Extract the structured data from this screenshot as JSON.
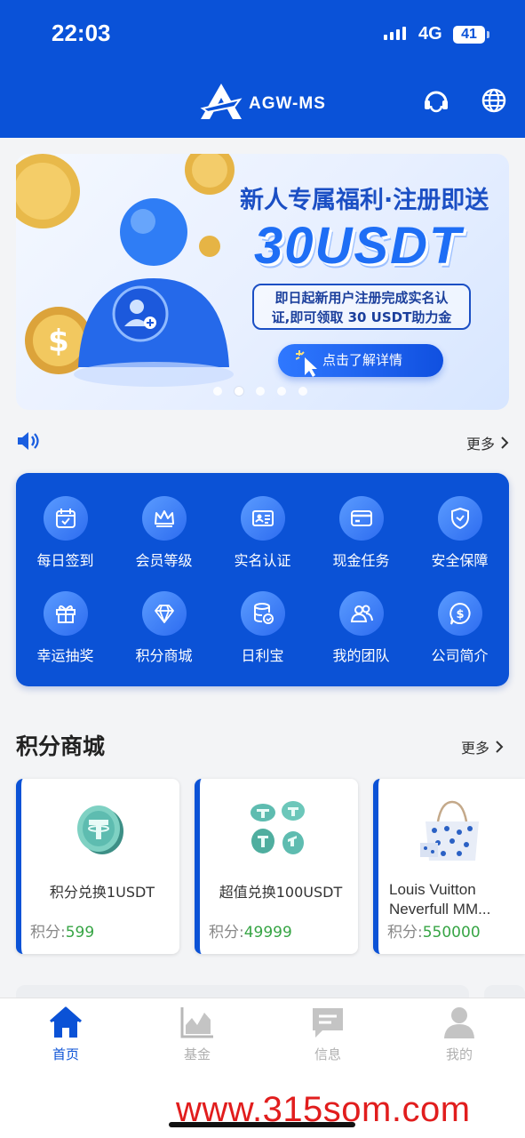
{
  "status_bar": {
    "time": "22:03",
    "network": "4G",
    "battery": "41"
  },
  "header": {
    "brand": "AGW-MS",
    "icons": [
      "headset-icon",
      "globe-icon"
    ]
  },
  "banner": {
    "title": "新人专属福利·注册即送",
    "amount": "30USDT",
    "desc_line1": "即日起新用户注册完成实名认",
    "desc_line2": "证,即可领取 30 USDT助力金",
    "button": "点击了解详情",
    "active_slide": 2,
    "slide_count": 5
  },
  "notice": {
    "more": "更多"
  },
  "quick_menu": [
    {
      "label": "每日签到",
      "icon": "calendar-icon"
    },
    {
      "label": "会员等级",
      "icon": "crown-icon"
    },
    {
      "label": "实名认证",
      "icon": "id-card-icon"
    },
    {
      "label": "现金任务",
      "icon": "credit-card-icon"
    },
    {
      "label": "安全保障",
      "icon": "shield-icon"
    },
    {
      "label": "幸运抽奖",
      "icon": "gift-icon"
    },
    {
      "label": "积分商城",
      "icon": "diamond-icon"
    },
    {
      "label": "日利宝",
      "icon": "database-icon"
    },
    {
      "label": "我的团队",
      "icon": "team-icon"
    },
    {
      "label": "公司简介",
      "icon": "dollar-chat-icon"
    }
  ],
  "mall": {
    "title": "积分商城",
    "more": "更多",
    "points_label": "积分:",
    "items": [
      {
        "name": "积分兑换1USDT",
        "points": "599"
      },
      {
        "name": "超值兑换100USDT",
        "points": "49999"
      },
      {
        "name": "Louis Vuitton Neverfull MM...",
        "points": "550000"
      }
    ]
  },
  "tabbar": [
    {
      "label": "首页",
      "active": true
    },
    {
      "label": "基金",
      "active": false
    },
    {
      "label": "信息",
      "active": false
    },
    {
      "label": "我的",
      "active": false
    }
  ],
  "watermark": "www.315som.com",
  "colors": {
    "primary": "#0b52d6",
    "points_green": "#37a545",
    "watermark_red": "#e11d1d"
  }
}
